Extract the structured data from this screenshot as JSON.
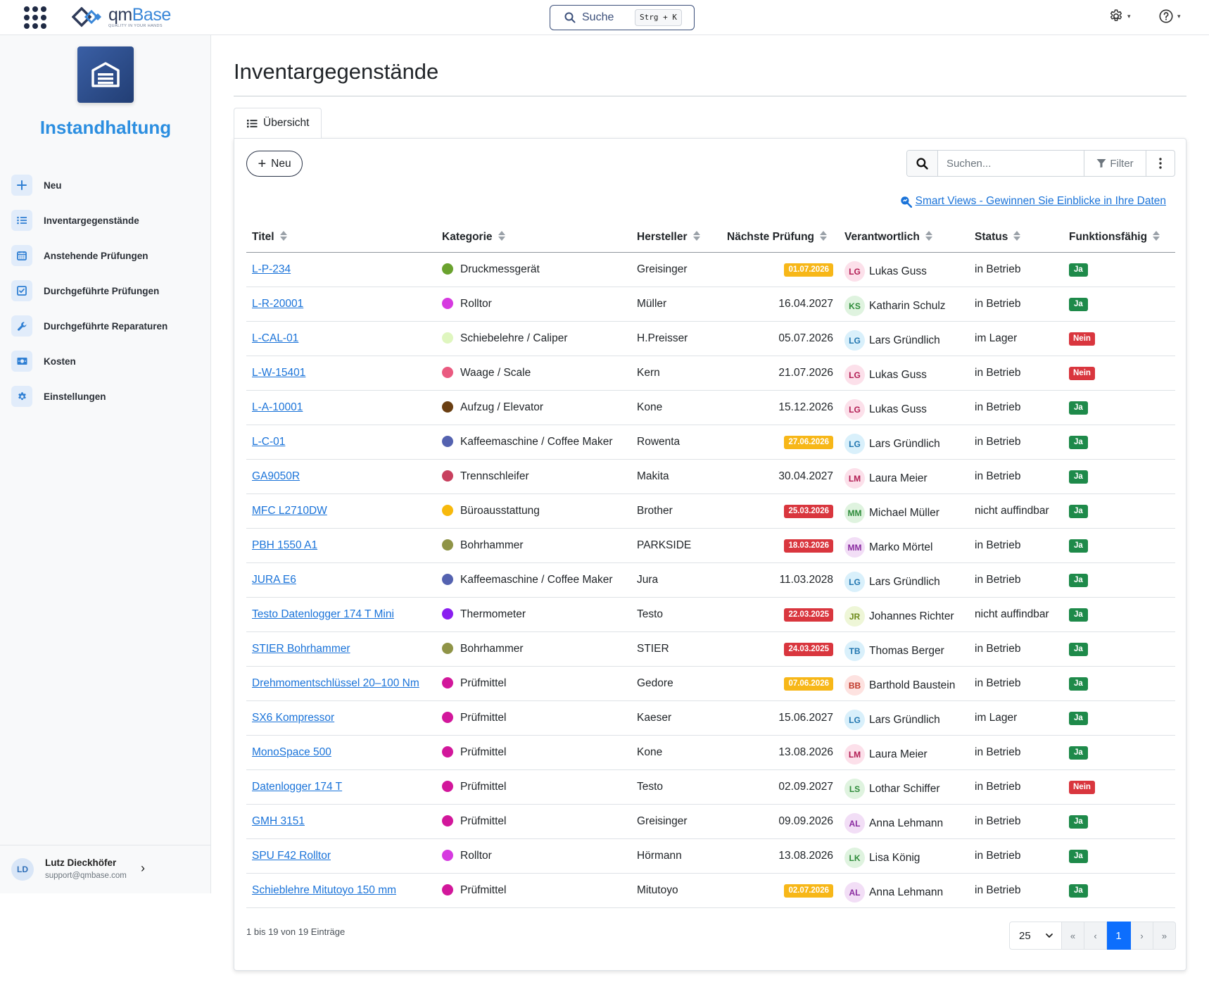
{
  "header": {
    "logo_text_a": "qm",
    "logo_text_b": "Base",
    "logo_tagline": "QUALITY IN YOUR HANDS",
    "search_label": "Suche",
    "search_shortcut": "Strg + K"
  },
  "sidebar": {
    "app_title": "Instandhaltung",
    "items": [
      {
        "label": "Neu",
        "icon": "plus-icon"
      },
      {
        "label": "Inventargegenstände",
        "icon": "list-icon"
      },
      {
        "label": "Anstehende Prüfungen",
        "icon": "calendar-icon"
      },
      {
        "label": "Durchgeführte Prüfungen",
        "icon": "checkbox-icon"
      },
      {
        "label": "Durchgeführte Reparaturen",
        "icon": "wrench-icon"
      },
      {
        "label": "Kosten",
        "icon": "money-icon"
      },
      {
        "label": "Einstellungen",
        "icon": "gear-icon"
      }
    ],
    "user": {
      "initials": "LD",
      "name": "Lutz Dieckhöfer",
      "email": "support@qmbase.com"
    }
  },
  "main": {
    "title": "Inventargegenstände",
    "tab_label": "Übersicht",
    "new_button": "Neu",
    "search_placeholder": "Suchen...",
    "filter_label": "Filter",
    "smart_views_link": "Smart Views - Gewinnen Sie Einblicke in Ihre Daten",
    "columns": [
      "Titel",
      "Kategorie",
      "Hersteller",
      "Nächste Prüfung",
      "Verantwortlich",
      "Status",
      "Funktionsfähig"
    ],
    "rows": [
      {
        "title": "L-P-234",
        "category": "Druckmessgerät",
        "cat_color": "#6aa22e",
        "maker": "Greisinger",
        "next_check": "01.07.2026",
        "check_state": "warn",
        "resp_initials": "LG",
        "resp_color": "pink",
        "resp_name": "Lukas Guss",
        "status": "in Betrieb",
        "functional": "Ja"
      },
      {
        "title": "L-R-20001",
        "category": "Rolltor",
        "cat_color": "#d63ae0",
        "maker": "Müller",
        "next_check": "16.04.2027",
        "check_state": "none",
        "resp_initials": "KS",
        "resp_color": "green",
        "resp_name": "Katharin Schulz",
        "status": "in Betrieb",
        "functional": "Ja"
      },
      {
        "title": "L-CAL-01",
        "category": "Schiebelehre / Caliper",
        "cat_color": "#dff6bf",
        "maker": "H.Preisser",
        "next_check": "05.07.2026",
        "check_state": "none",
        "resp_initials": "LG",
        "resp_color": "blue",
        "resp_name": "Lars Gründlich",
        "status": "im Lager",
        "functional": "Nein"
      },
      {
        "title": "L-W-15401",
        "category": "Waage / Scale",
        "cat_color": "#ea5a80",
        "maker": "Kern",
        "next_check": "21.07.2026",
        "check_state": "none",
        "resp_initials": "LG",
        "resp_color": "pink",
        "resp_name": "Lukas Guss",
        "status": "in Betrieb",
        "functional": "Nein"
      },
      {
        "title": "L-A-10001",
        "category": "Aufzug / Elevator",
        "cat_color": "#6a3f12",
        "maker": "Kone",
        "next_check": "15.12.2026",
        "check_state": "none",
        "resp_initials": "LG",
        "resp_color": "pink",
        "resp_name": "Lukas Guss",
        "status": "in Betrieb",
        "functional": "Ja"
      },
      {
        "title": "L-C-01",
        "category": "Kaffeemaschine / Coffee Maker",
        "cat_color": "#5462b0",
        "maker": "Rowenta",
        "next_check": "27.06.2026",
        "check_state": "warn",
        "resp_initials": "LG",
        "resp_color": "blue",
        "resp_name": "Lars Gründlich",
        "status": "in Betrieb",
        "functional": "Ja"
      },
      {
        "title": "GA9050R",
        "category": "Trennschleifer",
        "cat_color": "#c8405e",
        "maker": "Makita",
        "next_check": "30.04.2027",
        "check_state": "none",
        "resp_initials": "LM",
        "resp_color": "pink",
        "resp_name": "Laura Meier",
        "status": "in Betrieb",
        "functional": "Ja"
      },
      {
        "title": "MFC L2710DW",
        "category": "Büroausstattung",
        "cat_color": "#f7b90c",
        "maker": "Brother",
        "next_check": "25.03.2026",
        "check_state": "danger",
        "resp_initials": "MM",
        "resp_color": "green",
        "resp_name": "Michael Müller",
        "status": "nicht auffindbar",
        "functional": "Ja"
      },
      {
        "title": "PBH 1550 A1",
        "category": "Bohrhammer",
        "cat_color": "#8f9447",
        "maker": "PARKSIDE",
        "next_check": "18.03.2026",
        "check_state": "danger",
        "resp_initials": "MM",
        "resp_color": "purple",
        "resp_name": "Marko Mörtel",
        "status": "in Betrieb",
        "functional": "Ja"
      },
      {
        "title": "JURA E6",
        "category": "Kaffeemaschine / Coffee Maker",
        "cat_color": "#5462b0",
        "maker": "Jura",
        "next_check": "11.03.2028",
        "check_state": "none",
        "resp_initials": "LG",
        "resp_color": "blue",
        "resp_name": "Lars Gründlich",
        "status": "in Betrieb",
        "functional": "Ja"
      },
      {
        "title": "Testo Datenlogger 174 T Mini",
        "category": "Thermometer",
        "cat_color": "#8a1ef0",
        "maker": "Testo",
        "next_check": "22.03.2025",
        "check_state": "danger",
        "resp_initials": "JR",
        "resp_color": "lime",
        "resp_name": "Johannes Richter",
        "status": "nicht auffindbar",
        "functional": "Ja"
      },
      {
        "title": "STIER Bohrhammer",
        "category": "Bohrhammer",
        "cat_color": "#8f9447",
        "maker": "STIER",
        "next_check": "24.03.2025",
        "check_state": "danger",
        "resp_initials": "TB",
        "resp_color": "blue",
        "resp_name": "Thomas Berger",
        "status": "in Betrieb",
        "functional": "Ja"
      },
      {
        "title": "Drehmomentschlüssel 20–100 Nm",
        "category": "Prüfmittel",
        "cat_color": "#d2179b",
        "maker": "Gedore",
        "next_check": "07.06.2026",
        "check_state": "warn",
        "resp_initials": "BB",
        "resp_color": "rose",
        "resp_name": "Barthold Baustein",
        "status": "in Betrieb",
        "functional": "Ja"
      },
      {
        "title": "SX6 Kompressor",
        "category": "Prüfmittel",
        "cat_color": "#d2179b",
        "maker": "Kaeser",
        "next_check": "15.06.2027",
        "check_state": "none",
        "resp_initials": "LG",
        "resp_color": "blue",
        "resp_name": "Lars Gründlich",
        "status": "im Lager",
        "functional": "Ja"
      },
      {
        "title": "MonoSpace 500",
        "category": "Prüfmittel",
        "cat_color": "#d2179b",
        "maker": "Kone",
        "next_check": "13.08.2026",
        "check_state": "none",
        "resp_initials": "LM",
        "resp_color": "pink",
        "resp_name": "Laura Meier",
        "status": "in Betrieb",
        "functional": "Ja"
      },
      {
        "title": "Datenlogger 174 T",
        "category": "Prüfmittel",
        "cat_color": "#d2179b",
        "maker": "Testo",
        "next_check": "02.09.2027",
        "check_state": "none",
        "resp_initials": "LS",
        "resp_color": "green",
        "resp_name": "Lothar Schiffer",
        "status": "in Betrieb",
        "functional": "Nein"
      },
      {
        "title": "GMH 3151",
        "category": "Prüfmittel",
        "cat_color": "#d2179b",
        "maker": "Greisinger",
        "next_check": "09.09.2026",
        "check_state": "none",
        "resp_initials": "AL",
        "resp_color": "purple",
        "resp_name": "Anna Lehmann",
        "status": "in Betrieb",
        "functional": "Ja"
      },
      {
        "title": "SPU F42 Rolltor",
        "category": "Rolltor",
        "cat_color": "#d63ae0",
        "maker": "Hörmann",
        "next_check": "13.08.2026",
        "check_state": "none",
        "resp_initials": "LK",
        "resp_color": "green",
        "resp_name": "Lisa König",
        "status": "in Betrieb",
        "functional": "Ja"
      },
      {
        "title": "Schieblehre Mitutoyo 150 mm",
        "category": "Prüfmittel",
        "cat_color": "#d2179b",
        "maker": "Mitutoyo",
        "next_check": "02.07.2026",
        "check_state": "warn",
        "resp_initials": "AL",
        "resp_color": "purple",
        "resp_name": "Anna Lehmann",
        "status": "in Betrieb",
        "functional": "Ja"
      }
    ],
    "footer_info": "1 bis 19 von 19 Einträge",
    "page_size": "25",
    "pagination": {
      "first": "«",
      "prev": "‹",
      "current": "1",
      "next": "›",
      "last": "»"
    }
  }
}
